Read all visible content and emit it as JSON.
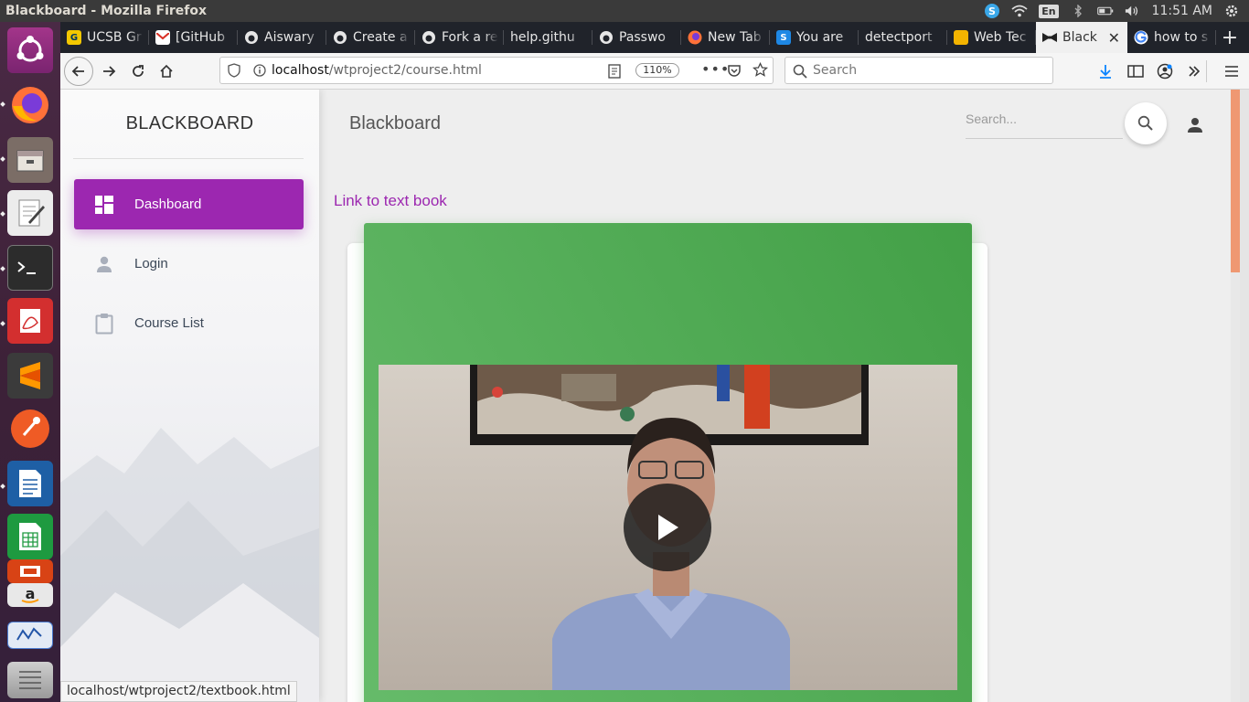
{
  "system": {
    "window_title": "Blackboard - Mozilla Firefox",
    "language": "En",
    "time": "11:51 AM"
  },
  "launcher": {
    "apps": [
      "ubuntu-dash-icon",
      "firefox-icon",
      "files-icon",
      "text-editor-icon",
      "terminal-icon",
      "document-viewer-icon",
      "sublime-text-icon",
      "postman-icon",
      "libreoffice-writer-icon",
      "libreoffice-calc-icon",
      "software-center-icon",
      "amazon-icon",
      "system-monitor-icon",
      "trash-stack-icon"
    ]
  },
  "browser": {
    "tabs": [
      {
        "label": "UCSB Gr",
        "icon": "ucsb-icon",
        "color": "#f3c800"
      },
      {
        "label": "[GitHub",
        "icon": "gmail-icon",
        "color": "#ffffff"
      },
      {
        "label": "Aiswary",
        "icon": "github-icon",
        "color": "#20232a"
      },
      {
        "label": "Create a",
        "icon": "github-icon",
        "color": "#20232a"
      },
      {
        "label": "Fork a re",
        "icon": "github-icon",
        "color": "#20232a"
      },
      {
        "label": "help.githu",
        "icon": "",
        "color": ""
      },
      {
        "label": "Passwo",
        "icon": "github-icon",
        "color": "#20232a"
      },
      {
        "label": "New Tab",
        "icon": "firefox-icon",
        "color": "#ff7139"
      },
      {
        "label": "You are",
        "icon": "s-icon",
        "color": "#1e88e5"
      },
      {
        "label": "detectport",
        "icon": "",
        "color": ""
      },
      {
        "label": "Web Tec",
        "icon": "slides-icon",
        "color": "#f4b400"
      },
      {
        "label": "Black",
        "icon": "bowtie-icon",
        "color": "#222222",
        "active": true
      },
      {
        "label": "how to s",
        "icon": "google-icon",
        "color": "#4285f4"
      }
    ],
    "url_host": "localhost",
    "url_path": "/wtproject2/course.html",
    "zoom": "110%",
    "search_placeholder": "Search",
    "status_url": "localhost/wtproject2/textbook.html"
  },
  "app": {
    "brand": "BLACKBOARD",
    "nav": [
      {
        "label": "Dashboard",
        "icon": "dashboard-icon",
        "active": true
      },
      {
        "label": "Login",
        "icon": "person-icon"
      },
      {
        "label": "Course List",
        "icon": "clipboard-icon"
      }
    ],
    "header_title": "Blackboard",
    "search_placeholder": "Search...",
    "textbook_link": "Link to text book",
    "accent": "#9c27b0",
    "card_color": "#4caf50"
  }
}
